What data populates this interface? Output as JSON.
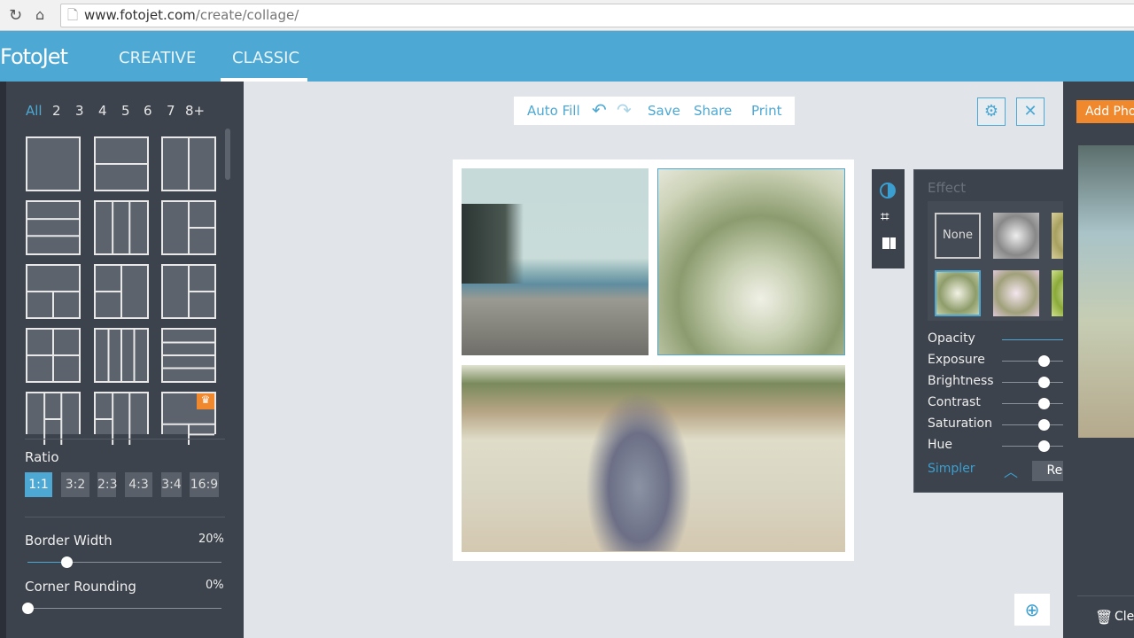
{
  "browser": {
    "url_host": "www.fotojet.com",
    "url_path": "/create/collage/"
  },
  "header": {
    "logo": "FotoJet",
    "tabs": [
      {
        "label": "CREATIVE"
      },
      {
        "label": "CLASSIC",
        "active": true
      }
    ]
  },
  "sidebar": {
    "counts": [
      "All",
      "2",
      "3",
      "4",
      "5",
      "6",
      "7",
      "8+"
    ],
    "active_count": "All",
    "ratio_label": "Ratio",
    "ratios": [
      "1:1",
      "3:2",
      "2:3",
      "4:3",
      "3:4",
      "16:9"
    ],
    "active_ratio": "1:1",
    "border_width": {
      "label": "Border Width",
      "value": "20%",
      "percent": 20
    },
    "corner_rounding": {
      "label": "Corner Rounding",
      "value": "0%",
      "percent": 0
    }
  },
  "toolbar": {
    "auto_fill": "Auto Fill",
    "save": "Save",
    "share": "Share",
    "print": "Print"
  },
  "effect_panel": {
    "title": "Effect",
    "none_label": "None",
    "sliders": [
      {
        "label": "Opacity",
        "value": "100",
        "percent": 100
      },
      {
        "label": "Exposure",
        "value": "0",
        "percent": 50
      },
      {
        "label": "Brightness",
        "value": "0",
        "percent": 50
      },
      {
        "label": "Contrast",
        "value": "0",
        "percent": 50
      },
      {
        "label": "Saturation",
        "value": "0",
        "percent": 50
      },
      {
        "label": "Hue",
        "value": "0",
        "percent": 50
      }
    ],
    "simpler": "Simpler",
    "reset_all": "Reset All"
  },
  "right_panel": {
    "add_photos": "Add Photos",
    "clear": "Clear"
  },
  "colors": {
    "accent": "#4da8d3",
    "panel": "#3d434c",
    "orange": "#f0892d"
  }
}
